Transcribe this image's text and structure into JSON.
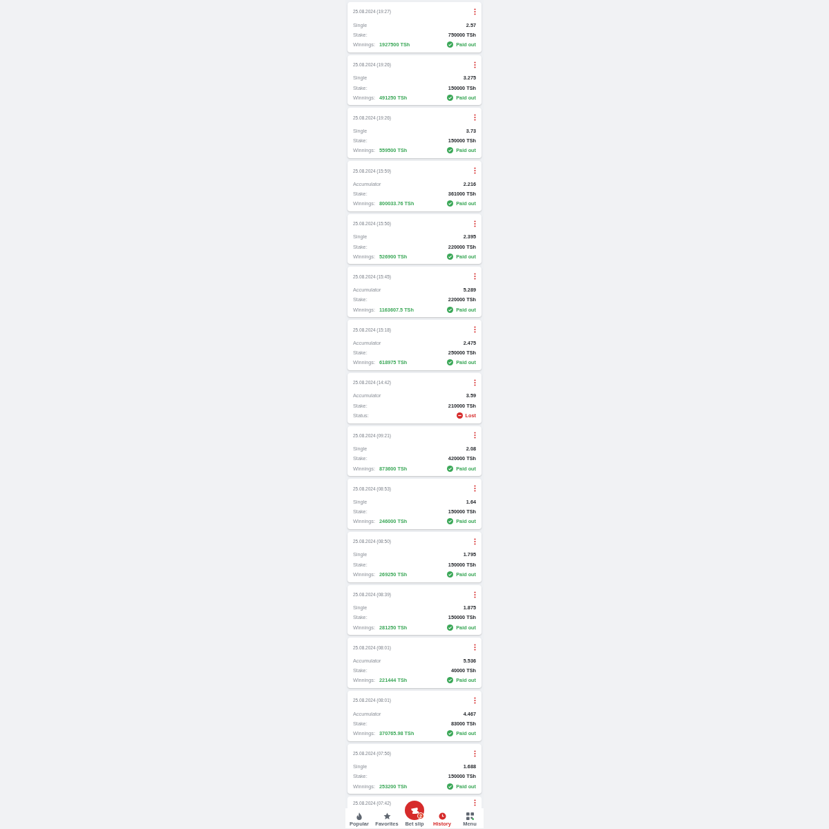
{
  "bets": [
    {
      "date": "25.08.2024 (19:27)",
      "type": "Single",
      "odds": "2.57",
      "stake_label": "Stake:",
      "stake": "750000 TSh",
      "result_label": "Winnings:",
      "winnings": "1927500 TSh",
      "status": {
        "kind": "paid",
        "text": "Paid out"
      }
    },
    {
      "date": "25.08.2024 (19:26)",
      "type": "Single",
      "odds": "3.275",
      "stake_label": "Stake:",
      "stake": "150000 TSh",
      "result_label": "Winnings:",
      "winnings": "491250 TSh",
      "status": {
        "kind": "paid",
        "text": "Paid out"
      }
    },
    {
      "date": "25.08.2024 (19:26)",
      "type": "Single",
      "odds": "3.73",
      "stake_label": "Stake:",
      "stake": "150000 TSh",
      "result_label": "Winnings:",
      "winnings": "559500 TSh",
      "status": {
        "kind": "paid",
        "text": "Paid out"
      }
    },
    {
      "date": "25.08.2024 (15:59)",
      "type": "Accumulator",
      "odds": "2.216",
      "stake_label": "Stake:",
      "stake": "361000 TSh",
      "result_label": "Winnings:",
      "winnings": "800033.76 TSh",
      "status": {
        "kind": "paid",
        "text": "Paid out"
      }
    },
    {
      "date": "25.08.2024 (15:56)",
      "type": "Single",
      "odds": "2.395",
      "stake_label": "Stake:",
      "stake": "220000 TSh",
      "result_label": "Winnings:",
      "winnings": "526900 TSh",
      "status": {
        "kind": "paid",
        "text": "Paid out"
      }
    },
    {
      "date": "25.08.2024 (15:45)",
      "type": "Accumulator",
      "odds": "5.289",
      "stake_label": "Stake:",
      "stake": "220000 TSh",
      "result_label": "Winnings:",
      "winnings": "1163607.5 TSh",
      "status": {
        "kind": "paid",
        "text": "Paid out"
      }
    },
    {
      "date": "25.08.2024 (15:18)",
      "type": "Accumulator",
      "odds": "2.475",
      "stake_label": "Stake:",
      "stake": "250000 TSh",
      "result_label": "Winnings:",
      "winnings": "618975 TSh",
      "status": {
        "kind": "paid",
        "text": "Paid out"
      }
    },
    {
      "date": "25.08.2024 (14:42)",
      "type": "Accumulator",
      "odds": "3.59",
      "stake_label": "Stake:",
      "stake": "210000 TSh",
      "result_label": "Status:",
      "status": {
        "kind": "lost",
        "text": "Lost"
      }
    },
    {
      "date": "25.08.2024 (09:21)",
      "type": "Single",
      "odds": "2.08",
      "stake_label": "Stake:",
      "stake": "420000 TSh",
      "result_label": "Winnings:",
      "winnings": "873600 TSh",
      "status": {
        "kind": "paid",
        "text": "Paid out"
      }
    },
    {
      "date": "25.08.2024 (08:53)",
      "type": "Single",
      "odds": "1.64",
      "stake_label": "Stake:",
      "stake": "150000 TSh",
      "result_label": "Winnings:",
      "winnings": "246000 TSh",
      "status": {
        "kind": "paid",
        "text": "Paid out"
      }
    },
    {
      "date": "25.08.2024 (08:50)",
      "type": "Single",
      "odds": "1.795",
      "stake_label": "Stake:",
      "stake": "150000 TSh",
      "result_label": "Winnings:",
      "winnings": "269250 TSh",
      "status": {
        "kind": "paid",
        "text": "Paid out"
      }
    },
    {
      "date": "25.08.2024 (08:39)",
      "type": "Single",
      "odds": "1.875",
      "stake_label": "Stake:",
      "stake": "150000 TSh",
      "result_label": "Winnings:",
      "winnings": "281250 TSh",
      "status": {
        "kind": "paid",
        "text": "Paid out"
      }
    },
    {
      "date": "25.08.2024 (08:01)",
      "type": "Accumulator",
      "odds": "5.536",
      "stake_label": "Stake:",
      "stake": "40000 TSh",
      "result_label": "Winnings:",
      "winnings": "221444 TSh",
      "status": {
        "kind": "paid",
        "text": "Paid out"
      }
    },
    {
      "date": "25.08.2024 (08:01)",
      "type": "Accumulator",
      "odds": "4.467",
      "stake_label": "Stake:",
      "stake": "83000 TSh",
      "result_label": "Winnings:",
      "winnings": "370765.98 TSh",
      "status": {
        "kind": "paid",
        "text": "Paid out"
      }
    },
    {
      "date": "25.08.2024 (07:56)",
      "type": "Single",
      "odds": "1.688",
      "stake_label": "Stake:",
      "stake": "150000 TSh",
      "result_label": "Winnings:",
      "winnings": "253200 TSh",
      "status": {
        "kind": "paid",
        "text": "Paid out"
      }
    },
    {
      "date": "25.08.2024 (07:42)"
    }
  ],
  "nav": [
    {
      "kind": "popular",
      "label": "Popular",
      "selected": false
    },
    {
      "kind": "favorites",
      "label": "Favorites",
      "selected": false
    },
    {
      "kind": "betslip",
      "label": "Bet slip",
      "selected": false,
      "badge": "2"
    },
    {
      "kind": "history",
      "label": "History",
      "selected": true
    },
    {
      "kind": "menu",
      "label": "Menu",
      "selected": false
    }
  ]
}
